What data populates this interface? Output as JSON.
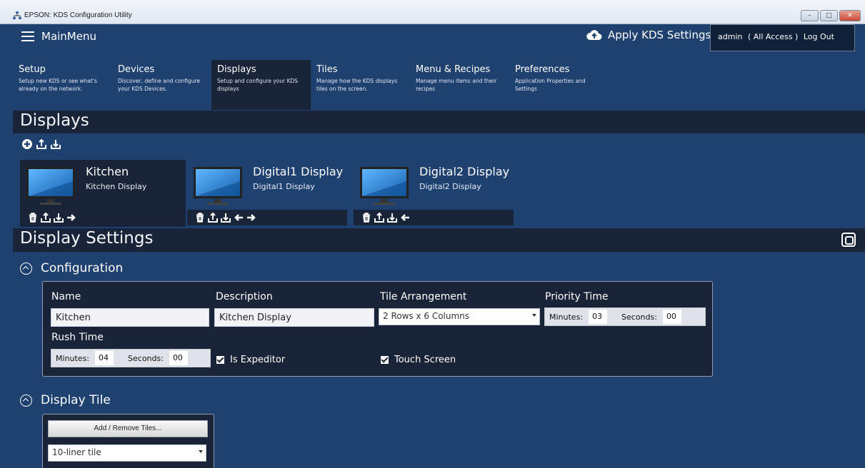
{
  "window": {
    "title": "EPSON: KDS Configuration Utility",
    "controls": [
      "–",
      "□",
      "✕"
    ]
  },
  "menubar": {
    "mainmenu_label": "MainMenu",
    "apply_label": "Apply KDS Settings",
    "user": "admin",
    "access": "( All Access )",
    "logout": "Log Out"
  },
  "nav": [
    {
      "title": "Setup",
      "desc": "Setup new KDS or see what's already on the network."
    },
    {
      "title": "Devices",
      "desc": "Discover, define and configure your KDS Devices."
    },
    {
      "title": "Displays",
      "desc": "Setup and configure your KDS displays"
    },
    {
      "title": "Tiles",
      "desc": "Manage how the KDS displays tiles on the screen."
    },
    {
      "title": "Menu & Recipes",
      "desc": "Manage menu items and their recipes"
    },
    {
      "title": "Preferences",
      "desc": "Application Properties and Settings"
    }
  ],
  "displays_header": "Displays",
  "cards": [
    {
      "name": "Kitchen",
      "desc": "Kitchen Display"
    },
    {
      "name": "Digital1 Display",
      "desc": "Digital1 Display"
    },
    {
      "name": "Digital2 Display",
      "desc": "Digital2 Display"
    }
  ],
  "settings_header": "Display Settings",
  "configuration": {
    "header": "Configuration",
    "name_label": "Name",
    "name_value": "Kitchen",
    "desc_label": "Description",
    "desc_value": "Kitchen Display",
    "tile_label": "Tile Arrangement",
    "tile_value": "2 Rows x 6 Columns",
    "priority_label": "Priority Time",
    "priority_minutes_label": "Minutes:",
    "priority_minutes": "03",
    "priority_seconds_label": "Seconds:",
    "priority_seconds": "00",
    "rush_label": "Rush Time",
    "rush_minutes_label": "Minutes:",
    "rush_minutes": "04",
    "rush_seconds_label": "Seconds:",
    "rush_seconds": "00",
    "expeditor_label": "Is Expeditor",
    "touch_label": "Touch Screen"
  },
  "display_tile": {
    "header": "Display Tile",
    "add_remove_label": "Add / Remove Tiles...",
    "tile_select": "10-liner tile"
  },
  "colors": {
    "bg": "#1f4170",
    "dark": "#1a2438",
    "accent": "#2a7fd0"
  }
}
